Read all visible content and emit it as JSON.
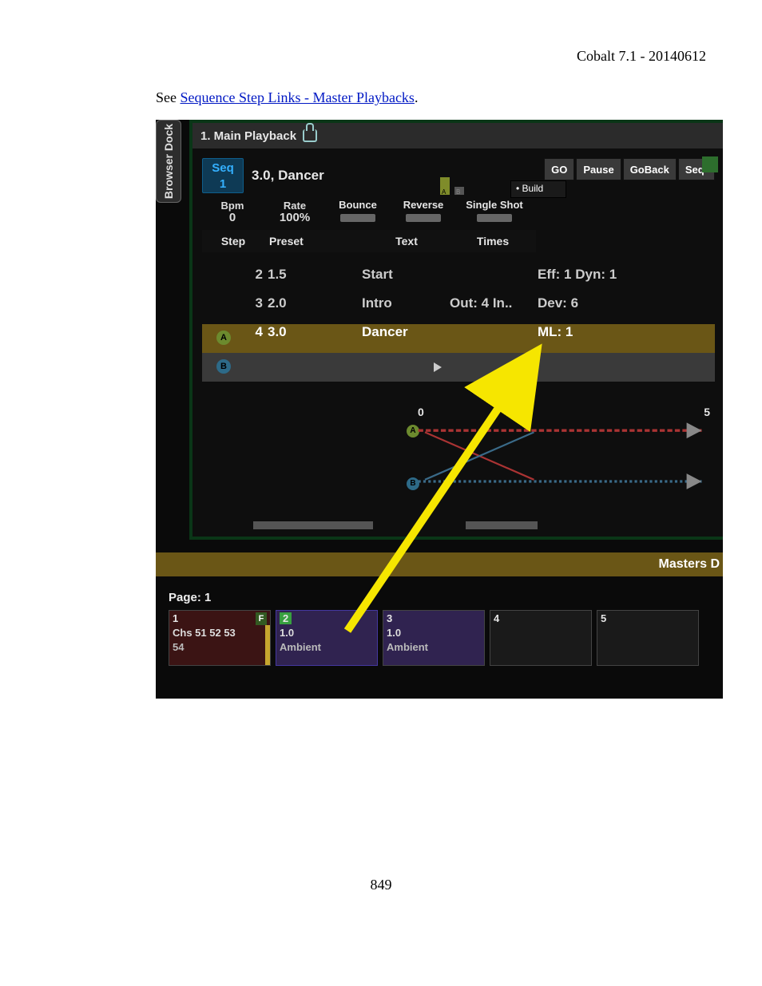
{
  "doc": {
    "header": "Cobalt 7.1 - 20140612",
    "intro_prefix": "See ",
    "link_text": "Sequence Step Links - Master Playbacks",
    "intro_suffix": ".",
    "page_number": "849"
  },
  "dock": {
    "label": "Browser Dock"
  },
  "titlebar": {
    "title": "1. Main Playback"
  },
  "seq": {
    "seq_label": "Seq",
    "seq_num": "1",
    "seq_name": "3.0, Dancer",
    "go_label": "GO",
    "pause_label": "Pause",
    "goback_label": "GoBack",
    "seqminus_label": "Seq-",
    "build_label": "• Build"
  },
  "mini": {
    "bpm_label": "Bpm",
    "bpm_value": "0",
    "rate_label": "Rate",
    "rate_value": "100%",
    "bounce_label": "Bounce",
    "reverse_label": "Reverse",
    "single_label": "Single Shot"
  },
  "cols": {
    "step": "Step",
    "preset": "Preset",
    "text": "Text",
    "times": "Times"
  },
  "rows": [
    {
      "step": "2",
      "preset": "1.5",
      "text": "Start",
      "times": "",
      "extra": "Eff: 1   Dyn: 1"
    },
    {
      "step": "3",
      "preset": "2.0",
      "text": "Intro",
      "times": "Out: 4   In..",
      "extra": "Dev: 6"
    },
    {
      "step": "4",
      "preset": "3.0",
      "text": "Dancer",
      "times": "",
      "extra": "ML: 1"
    }
  ],
  "graph": {
    "t0": "0",
    "t1": "5",
    "labelA": "A",
    "labelB": "B"
  },
  "masters_label": "Masters D",
  "page_label": "Page: 1",
  "masters": [
    {
      "num": "1",
      "letter": "F",
      "line1": "Chs 51 52 53",
      "line2": "54"
    },
    {
      "num": "2",
      "line1": "1.0",
      "line2": "Ambient"
    },
    {
      "num": "3",
      "line1": "1.0",
      "line2": "Ambient"
    },
    {
      "num": "4",
      "line1": "",
      "line2": ""
    },
    {
      "num": "5",
      "line1": "",
      "line2": ""
    }
  ]
}
